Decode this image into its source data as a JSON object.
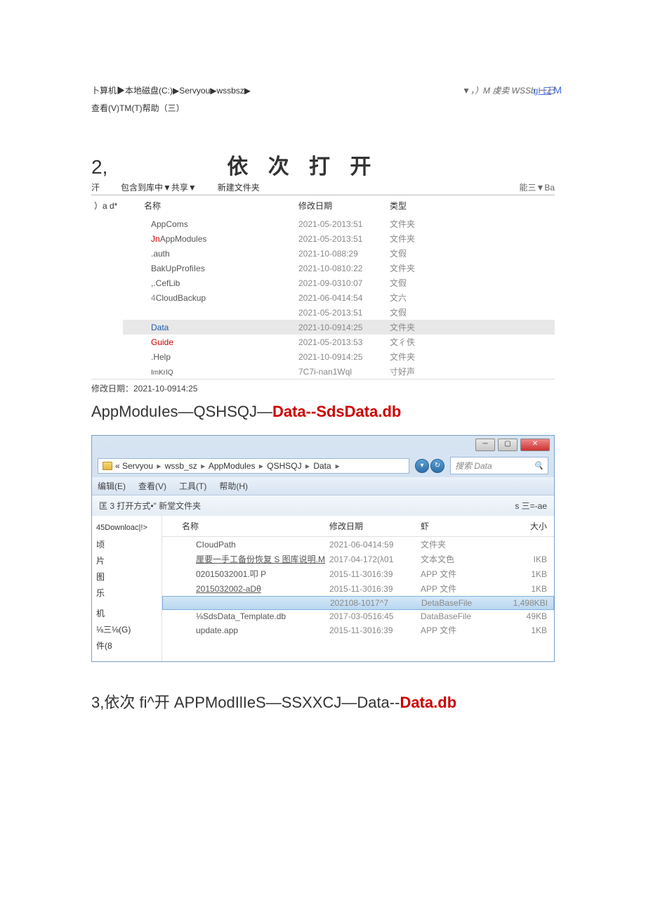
{
  "top": {
    "link1": "gI 口",
    "link2": "M"
  },
  "breadcrumb": "卜算机▶本地磁盘(C:)▶Servyou▶wssbsz▶",
  "search_hint": "▼，）M 虔卖 WSSb 一己",
  "menu1": "查看(V)TM(T)帮助（三）",
  "section2": {
    "num": "2,",
    "title": "依 次 打 开",
    "toolbar_left1": "汗",
    "toolbar_left2": "包含到库中▼共享▼",
    "toolbar_left3": "新建文件夹",
    "toolbar_right": "能三▼Ba",
    "sidebar": "）a\nd*",
    "headers": {
      "name": "名称",
      "date": "修改日期",
      "type": "类型"
    },
    "rows": [
      {
        "name": "AppComs",
        "date": "2021-05-2013:51",
        "type": "文件夹",
        "style": ""
      },
      {
        "name_pre": "Jn",
        "name": "AppModules",
        "date": "2021-05-2013:51",
        "type": "文件夹",
        "style": "jn"
      },
      {
        "name": ".auth",
        "date": "2021-10-088:29",
        "type": "文假",
        "style": ""
      },
      {
        "name": "BakUpProfiIes",
        "date": "2021-10-0810:22",
        "type": "文件夹",
        "style": ""
      },
      {
        "name": ",.CefLib",
        "date": "2021-09-0310:07",
        "type": "文假",
        "style": ""
      },
      {
        "name_pre": "4",
        "name": "CloudBackup",
        "date": "2021-06-0414:54",
        "type": "文六",
        "style": "four"
      },
      {
        "name": "",
        "date": "2021-05-2013:51",
        "type": "文假",
        "style": ""
      },
      {
        "name": "Data",
        "date": "2021-10-0914:25",
        "type": "文件夹",
        "style": "highlight"
      },
      {
        "name": "Guide",
        "date": "2021-05-2013:53",
        "type": "文彳佚",
        "style": "red"
      },
      {
        "name": ".Help",
        "date": "2021-10-0914:25",
        "type": "文件夹",
        "style": ""
      },
      {
        "name": "ImKrIQ",
        "date": "7C7i-nan1Wql",
        "type": "寸好声",
        "style": "small"
      }
    ],
    "status": "修改日期：2021-10-0914:25"
  },
  "path_title": {
    "pre": "AppModuIes—QSHSQJ—",
    "red": "Data--SdsData.db"
  },
  "win7": {
    "address_parts": [
      "« Servyou",
      "wssb_sz",
      "AppModules",
      "QSHSQJ",
      "Data"
    ],
    "search_placeholder": "搜索 Data",
    "menu": [
      "编辑(E)",
      "查看(V)",
      "工具(T)",
      "帮助(H)"
    ],
    "toolbar_left": "匡 3 打开方式•\"     新堂文件夹",
    "toolbar_right": "s 三=-ae",
    "sidebar_top": "45Downloac|!>",
    "sidebar_items": [
      "顷",
      "片",
      "图",
      "乐",
      "",
      "机",
      "⅛三⅛(G)",
      "件(8"
    ],
    "headers": {
      "name": "名称",
      "date": "修改日期",
      "type": "虾",
      "size": "大小"
    },
    "rows": [
      {
        "name": "CIoudPath",
        "date": "2021-06-0414:59",
        "type": "文件夹",
        "size": ""
      },
      {
        "name": "厘要一手工备份恢复 S 图库说明.M",
        "date": "2017-04-172(λ01",
        "type": "文本文色",
        "size": "IKB",
        "underline": true
      },
      {
        "name": "02015032001.叩 P",
        "date": "2015-11-3016:39",
        "type": "APP 文件",
        "size": "1KB"
      },
      {
        "name": "2015032002-aDθ",
        "date": "2015-11-3016:39",
        "type": "APP 文件",
        "size": "1KB",
        "underline": true
      },
      {
        "name": "",
        "date": "202108-1017^7",
        "type": "DetaBaseFile",
        "size": "1,498KBI",
        "selected": true
      },
      {
        "name": "⅛SdsData_Template.db",
        "date": "2017-03-0516:45",
        "type": "DataBaseFile",
        "size": "49KB"
      },
      {
        "name": "update.app",
        "date": "2015-11-3016:39",
        "type": "APP 文件",
        "size": "1KB"
      }
    ]
  },
  "section3": {
    "pre": "3,依次 fi^开 APPModIlIeS—SSXXCJ—Data--",
    "red": "Data.db"
  }
}
